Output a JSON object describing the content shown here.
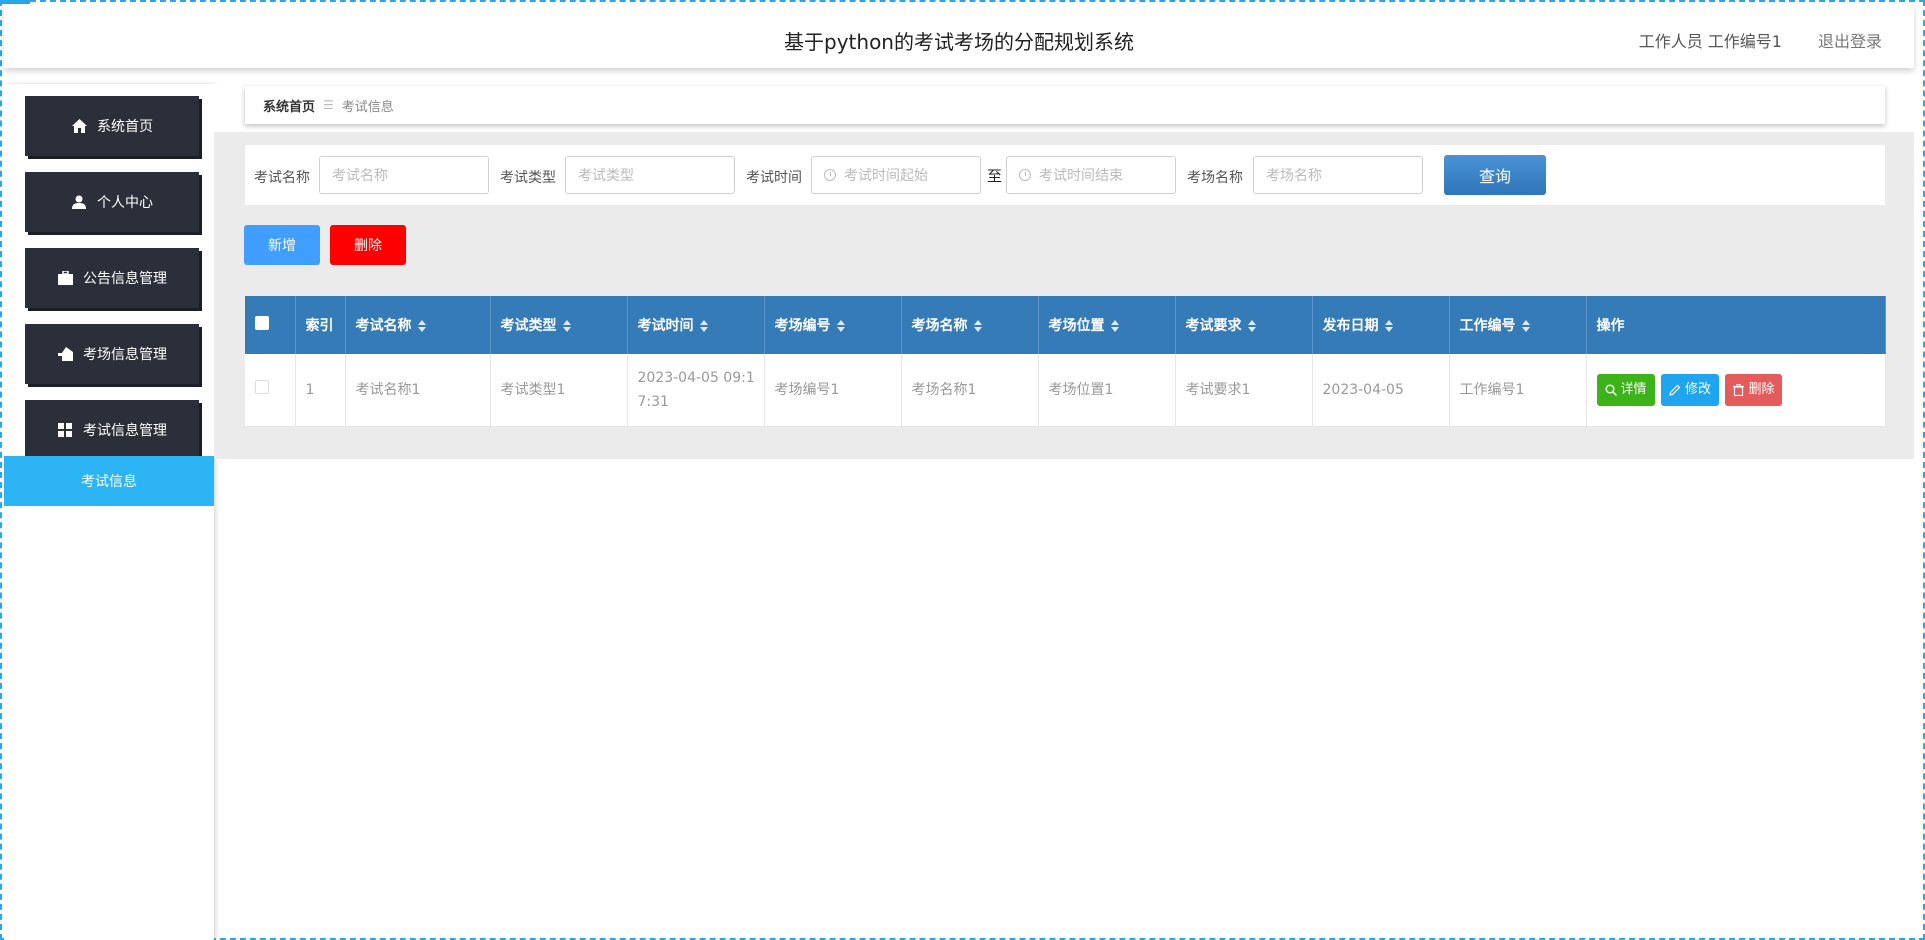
{
  "header": {
    "title": "基于python的考试考场的分配规划系统",
    "user": "工作人员 工作编号1",
    "logout": "退出登录"
  },
  "sidebar": {
    "items": [
      {
        "label": "系统首页",
        "icon": "home-icon"
      },
      {
        "label": "个人中心",
        "icon": "user-icon"
      },
      {
        "label": "公告信息管理",
        "icon": "briefcase-icon"
      },
      {
        "label": "考场信息管理",
        "icon": "house-hand-icon"
      },
      {
        "label": "考试信息管理",
        "icon": "grid-icon"
      }
    ],
    "submenu": "考试信息"
  },
  "breadcrumb": {
    "home": "系统首页",
    "separator": "☰",
    "current": "考试信息"
  },
  "search": {
    "exam_name_label": "考试名称",
    "exam_name_placeholder": "考试名称",
    "exam_type_label": "考试类型",
    "exam_type_placeholder": "考试类型",
    "exam_time_label": "考试时间",
    "time_start_placeholder": "考试时间起始",
    "to_label": "至",
    "time_end_placeholder": "考试时间结束",
    "room_name_label": "考场名称",
    "room_name_placeholder": "考场名称",
    "query_button": "查询"
  },
  "toolbar": {
    "add_label": "新增",
    "delete_label": "删除"
  },
  "table": {
    "headers": [
      "索引",
      "考试名称",
      "考试类型",
      "考试时间",
      "考场编号",
      "考场名称",
      "考场位置",
      "考试要求",
      "发布日期",
      "工作编号",
      "操作"
    ],
    "rows": [
      {
        "index": "1",
        "exam_name": "考试名称1",
        "exam_type": "考试类型1",
        "exam_time": "2023-04-05 09:17:31",
        "room_no": "考场编号1",
        "room_name": "考场名称1",
        "room_location": "考场位置1",
        "requirement": "考试要求1",
        "publish_date": "2023-04-05",
        "staff_no": "工作编号1",
        "actions": {
          "detail": "详情",
          "edit": "修改",
          "delete": "删除"
        }
      }
    ]
  },
  "colors": {
    "sidebar_bg": "#2b2f3a",
    "submenu_active": "#2db4f5",
    "table_header": "#357bb8",
    "add_button": "#409eff",
    "delete_button": "#ff0000",
    "detail_button": "#3cb318",
    "edit_button": "#1fa4ef",
    "row_delete_button": "#e35b5a"
  }
}
